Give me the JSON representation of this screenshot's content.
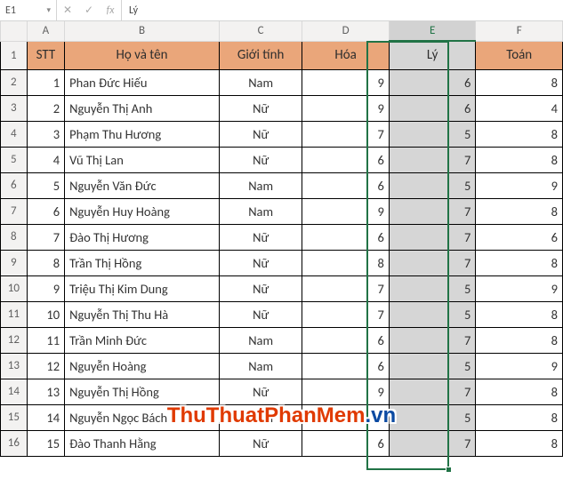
{
  "formula_bar": {
    "name_box": "E1",
    "value": "Lý"
  },
  "columns": [
    "A",
    "B",
    "C",
    "D",
    "E",
    "F"
  ],
  "selected_column": "E",
  "header_row_number": 1,
  "watermark": {
    "part1": "ThuThuatPhanMem",
    "part2": ".vn"
  },
  "chart_data": {
    "type": "table",
    "headers": [
      "STT",
      "Họ và tên",
      "Giới tính",
      "Hóa",
      "Lý",
      "Toán"
    ],
    "rows": [
      [
        1,
        "Phan Đức Hiếu",
        "Nam",
        9,
        6,
        8
      ],
      [
        2,
        "Nguyễn Thị Anh",
        "Nữ",
        9,
        6,
        4
      ],
      [
        3,
        "Phạm Thu Hương",
        "Nữ",
        7,
        5,
        8
      ],
      [
        4,
        "Vũ Thị Lan",
        "Nữ",
        6,
        7,
        8
      ],
      [
        5,
        "Nguyễn Văn Đức",
        "Nam",
        6,
        5,
        9
      ],
      [
        6,
        "Nguyễn Huy Hoàng",
        "Nam",
        9,
        7,
        8
      ],
      [
        7,
        "Đào Thị Hương",
        "Nữ",
        6,
        7,
        6
      ],
      [
        8,
        "Trần Thị Hồng",
        "Nữ",
        8,
        7,
        8
      ],
      [
        9,
        "Triệu Thị Kim Dung",
        "Nữ",
        7,
        5,
        9
      ],
      [
        10,
        "Nguyễn Thị Thu Hà",
        "Nữ",
        7,
        5,
        8
      ],
      [
        11,
        "Trần Minh Đức",
        "Nam",
        6,
        7,
        8
      ],
      [
        12,
        "Nguyễn Hoàng",
        "Nam",
        6,
        5,
        9
      ],
      [
        13,
        "Nguyễn Thị Hồng",
        "Nữ",
        9,
        7,
        8
      ],
      [
        14,
        "Nguyễn Ngọc Bách",
        "Nam",
        7,
        5,
        8
      ],
      [
        15,
        "Đào Thanh Hằng",
        "Nữ",
        6,
        7,
        8
      ]
    ]
  }
}
